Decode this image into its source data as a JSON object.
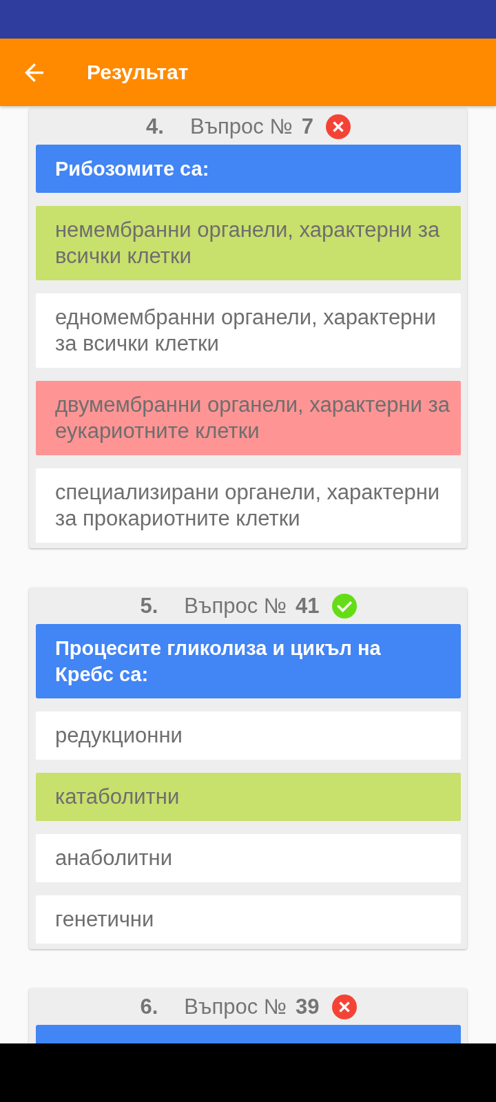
{
  "app_bar": {
    "title": "Результат"
  },
  "questions": [
    {
      "index": "4.",
      "label": "Въпрос №",
      "number": "7",
      "correct": false,
      "text": "Рибозомите са:",
      "answers": [
        {
          "text": "немембранни органели, характерни за всички клетки",
          "kind": "correct"
        },
        {
          "text": "едномембранни органели, характерни за всички клетки",
          "kind": "neutral"
        },
        {
          "text": "двумембранни органели, характерни за еукариотните клетки",
          "kind": "incorrect"
        },
        {
          "text": "специализирани органели, характерни за прокариотните клетки",
          "kind": "neutral"
        }
      ]
    },
    {
      "index": "5.",
      "label": "Въпрос №",
      "number": "41",
      "correct": true,
      "text": "Процесите гликолиза и цикъл на Кребс са:",
      "answers": [
        {
          "text": "редукционни",
          "kind": "neutral"
        },
        {
          "text": "катаболитни",
          "kind": "correct"
        },
        {
          "text": "анаболитни",
          "kind": "neutral"
        },
        {
          "text": "генетични",
          "kind": "neutral"
        }
      ]
    },
    {
      "index": "6.",
      "label": "Въпрос №",
      "number": "39",
      "correct": false
    }
  ]
}
